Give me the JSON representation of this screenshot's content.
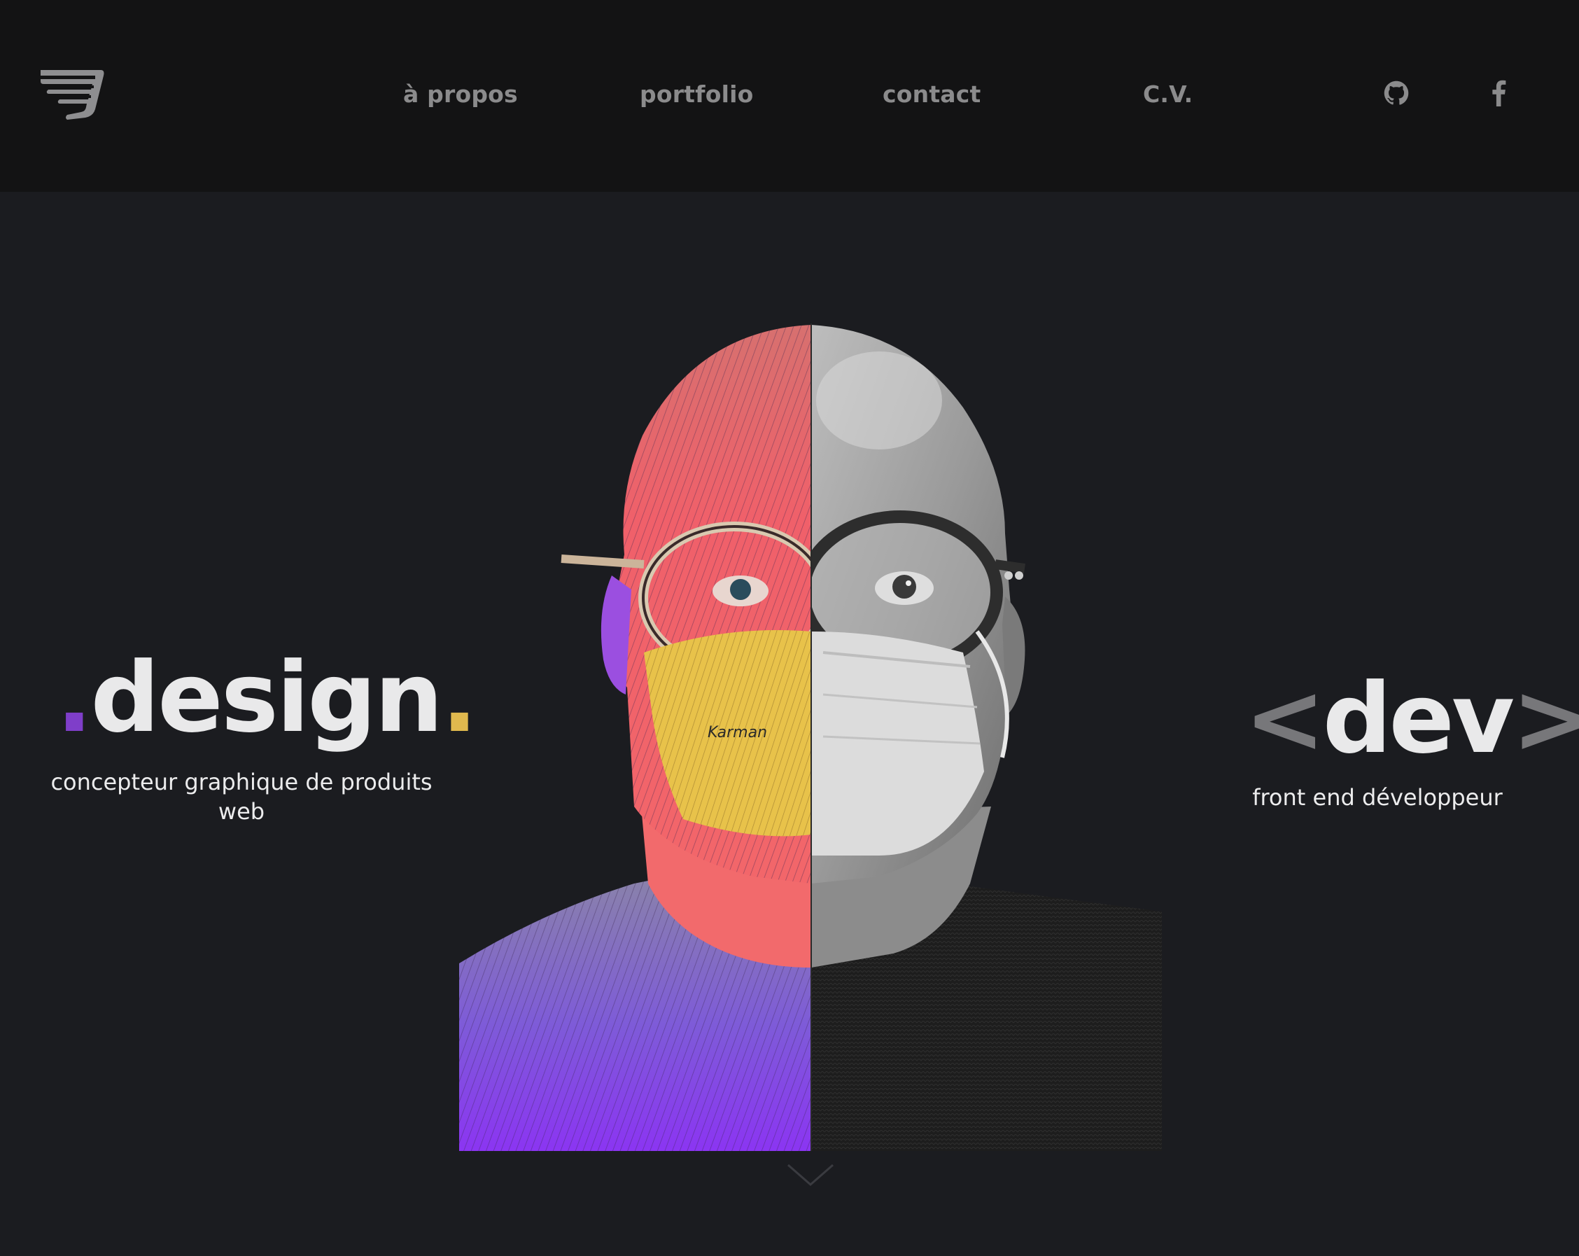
{
  "header": {
    "logo_name": "brand-logo",
    "nav": {
      "apropos": "à propos",
      "portfolio": "portfolio",
      "contact": "contact",
      "cv": "C.V."
    },
    "social": {
      "github_icon": "github-icon",
      "facebook_icon": "facebook-icon"
    }
  },
  "hero": {
    "design": {
      "dot_left": ".",
      "word": "design",
      "dot_right": ".",
      "subtitle": "concepteur graphique de produits web"
    },
    "dev": {
      "open_bracket": "<",
      "word": "dev",
      "close_bracket": ">",
      "subtitle": "front end développeur"
    },
    "portrait": {
      "mask_text": "Karman"
    },
    "scroll_icon": "chevron-down-icon"
  },
  "colors": {
    "background": "#1b1c20",
    "header_background": "#131314",
    "nav_text": "#8b8b8c",
    "accent_purple": "#7f3ec9",
    "accent_yellow": "#e0b94e",
    "bracket_gray": "#77777a",
    "heading_text": "#e9e9ea"
  }
}
